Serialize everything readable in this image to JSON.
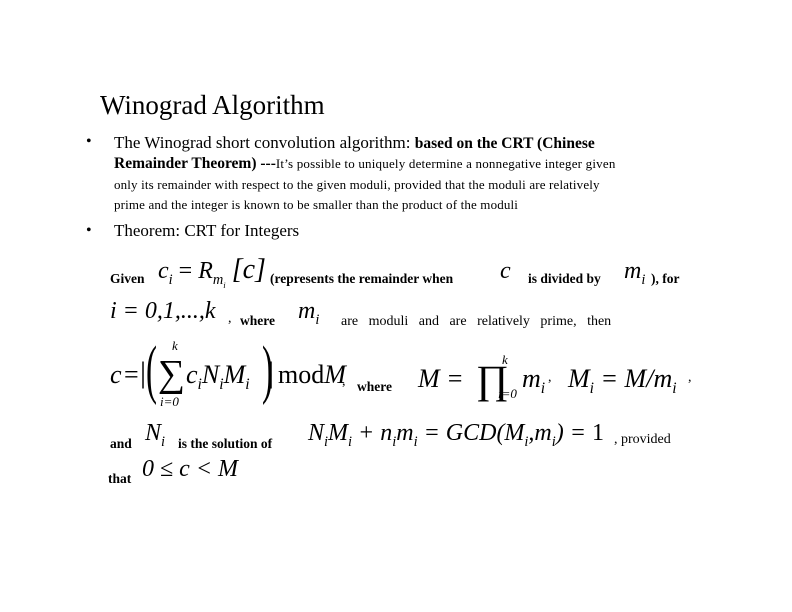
{
  "slide": {
    "title": "Winograd Algorithm",
    "bullets": [
      {
        "symbol": "•",
        "lead": "The Winograd short convolution algorithm:",
        "lead_bold": "based on the CRT (Chinese",
        "line2_bold": "Remainder Theorem) ---",
        "line2_small": "It’s possible to uniquely determine a nonnegative integer given",
        "line3": "only its remainder with respect to the given moduli, provided that the moduli are relatively",
        "line4": "prime and the integer is known to be smaller than the product of the moduli"
      },
      {
        "symbol": "•",
        "text": "Theorem: CRT for Integers"
      }
    ],
    "theorem": {
      "given": "Given",
      "eq1_lhs": "c",
      "eq1_lhs_sub": "i",
      "eq1_eq": "=",
      "eq1_R": "R",
      "eq1_R_sub": "m",
      "eq1_R_subsub": "i",
      "eq1_arg": "[c]",
      "represents": "(represents the remainder when",
      "c": "c",
      "divided_by": "is divided by",
      "m": "m",
      "m_sub": "i",
      "for": "), for",
      "index_range": "i = 0,1,...,k",
      "comma": ",",
      "where1": "where",
      "moduli_text": "are   moduli   and   are   relatively   prime,   then",
      "crt_c": "c",
      "crt_eq": "=",
      "crt_sum_top": "k",
      "crt_sum_bottom": "i=0",
      "crt_term": "c",
      "crt_mod": "mod",
      "crt_M": "M",
      "where2": "where",
      "M_def_lhs": "M =",
      "prod_top": "k",
      "prod_bottom": "i=0",
      "Mi_def": "M",
      "and": "and",
      "N": "N",
      "is_solution": "is the solution of",
      "gcd_eq": "GCD(M",
      "provided": ", provided",
      "that": "that",
      "range": "0 ≤ c < M"
    }
  }
}
